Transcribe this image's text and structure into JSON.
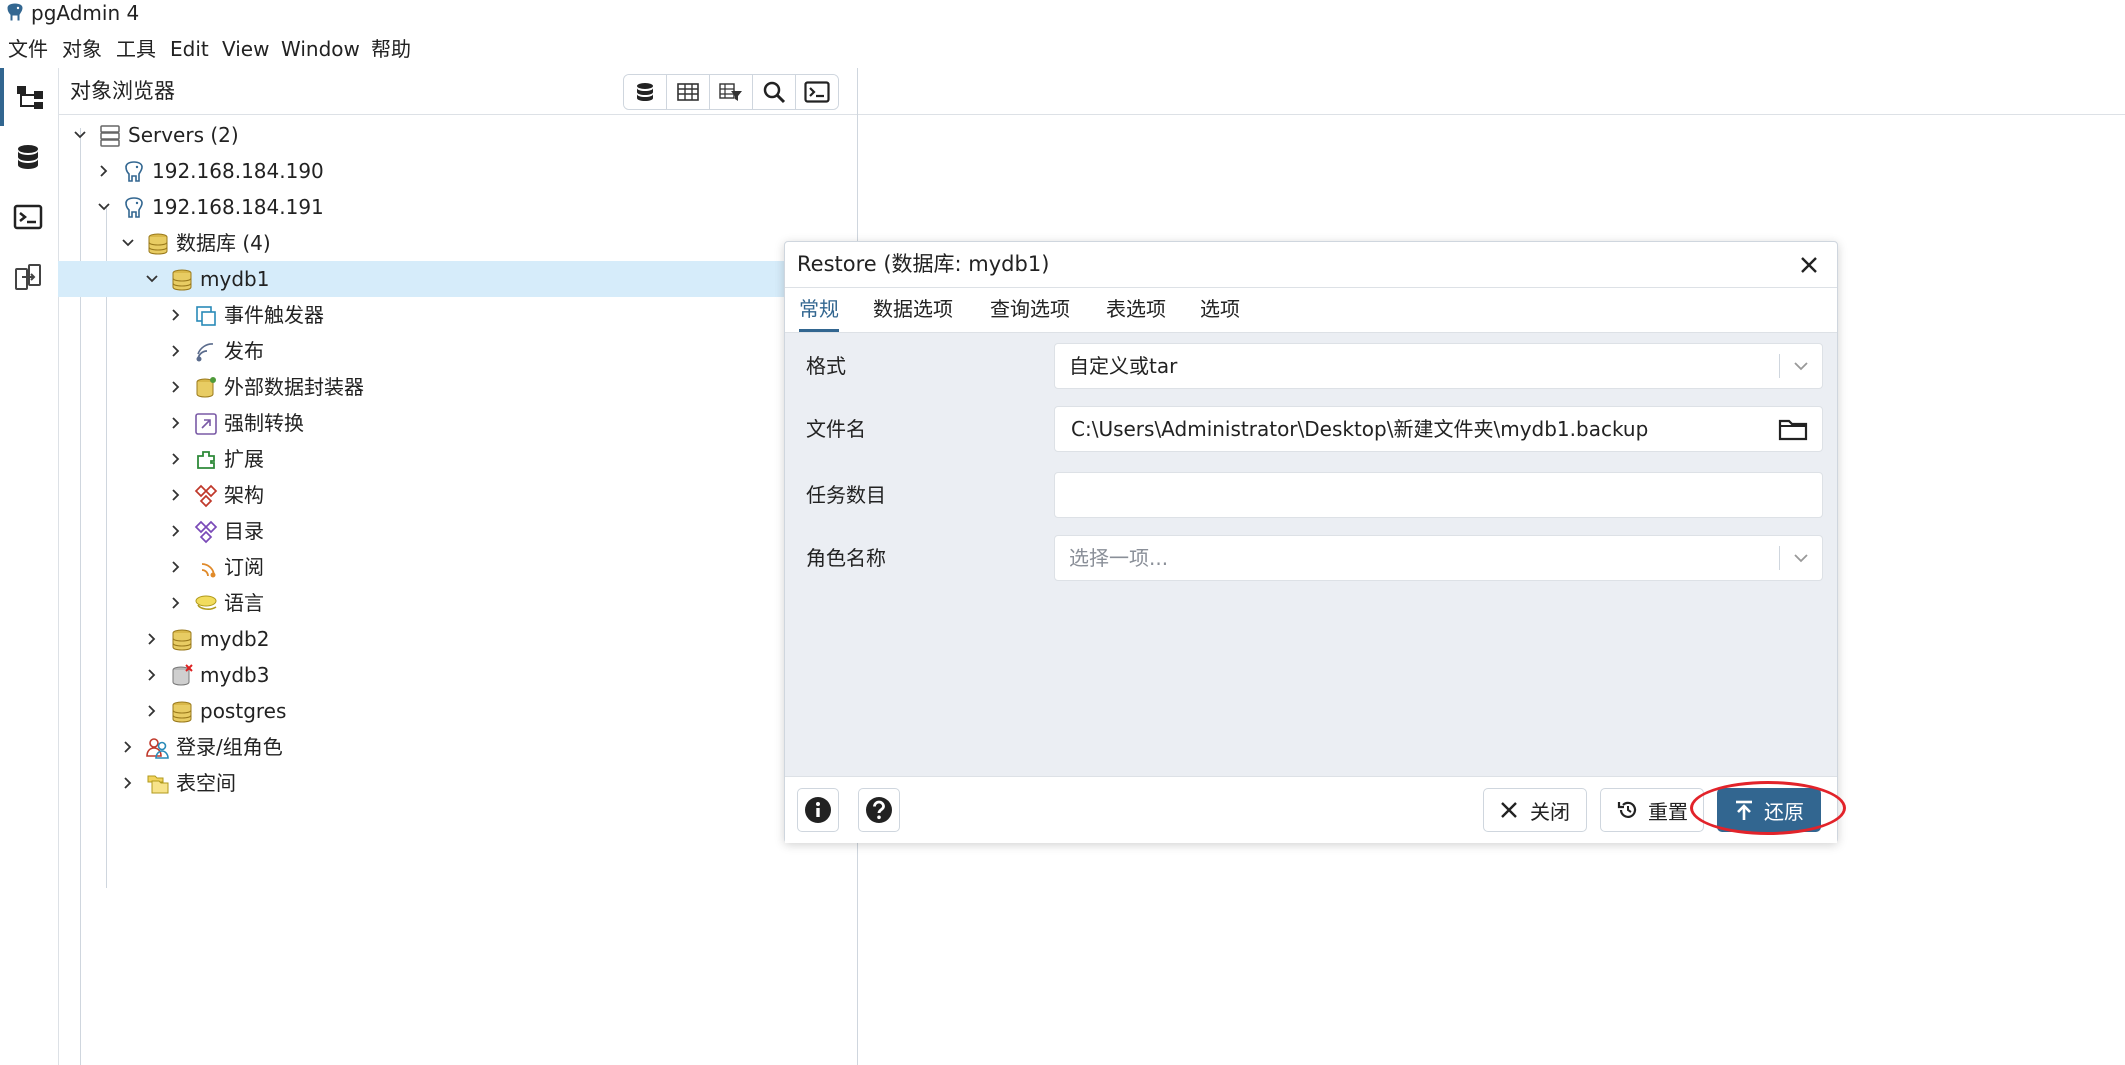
{
  "window": {
    "title": "pgAdmin 4",
    "app_icon": "elephant-icon"
  },
  "menu": [
    "文件",
    "对象",
    "工具",
    "Edit",
    "View",
    "Window",
    "帮助"
  ],
  "left_strip": [
    "object-explorer-icon",
    "query-tool-database-icon",
    "psql-terminal-icon",
    "schema-diff-icon"
  ],
  "browser": {
    "title": "对象浏览器",
    "toolbar": [
      "database-icon",
      "table-icon",
      "filtered-rows-icon",
      "search-icon",
      "terminal-icon"
    ]
  },
  "tree": [
    {
      "label": "Servers (2)",
      "icon": "servers-icon",
      "expanded": true
    },
    {
      "label": "192.168.184.190",
      "icon": "elephant-icon",
      "expanded": false
    },
    {
      "label": "192.168.184.191",
      "icon": "elephant-icon",
      "expanded": true
    },
    {
      "label": "数据库 (4)",
      "icon": "databases-icon",
      "expanded": true
    },
    {
      "label": "mydb1",
      "icon": "database-icon",
      "expanded": true,
      "selected": true
    },
    {
      "label": "事件触发器",
      "icon": "event-trigger-icon"
    },
    {
      "label": "发布",
      "icon": "publication-icon"
    },
    {
      "label": "外部数据封装器",
      "icon": "foreign-data-wrapper-icon"
    },
    {
      "label": "强制转换",
      "icon": "cast-icon"
    },
    {
      "label": "扩展",
      "icon": "extension-icon"
    },
    {
      "label": "架构",
      "icon": "schema-icon"
    },
    {
      "label": "目录",
      "icon": "catalog-icon"
    },
    {
      "label": "订阅",
      "icon": "subscription-icon"
    },
    {
      "label": "语言",
      "icon": "language-icon"
    },
    {
      "label": "mydb2",
      "icon": "database-icon"
    },
    {
      "label": "mydb3",
      "icon": "database-disconnected-icon"
    },
    {
      "label": "postgres",
      "icon": "database-icon"
    },
    {
      "label": "登录/组角色",
      "icon": "roles-icon"
    },
    {
      "label": "表空间",
      "icon": "tablespaces-icon"
    }
  ],
  "dialog": {
    "title": "Restore (数据库: mydb1)",
    "tabs": [
      "常规",
      "数据选项",
      "查询选项",
      "表选项",
      "选项"
    ],
    "active_tab": "常规",
    "fields": {
      "format": {
        "label": "格式",
        "value": "自定义或tar"
      },
      "filename": {
        "label": "文件名",
        "value": "C:\\Users\\Administrator\\Desktop\\新建文件夹\\mydb1.backup"
      },
      "jobs": {
        "label": "任务数目",
        "value": ""
      },
      "role": {
        "label": "角色名称",
        "placeholder": "选择一项..."
      }
    },
    "buttons": {
      "close": "关闭",
      "reset": "重置",
      "restore": "还原"
    },
    "accent_color": "#326690",
    "highlight_color": "#e2232a"
  }
}
